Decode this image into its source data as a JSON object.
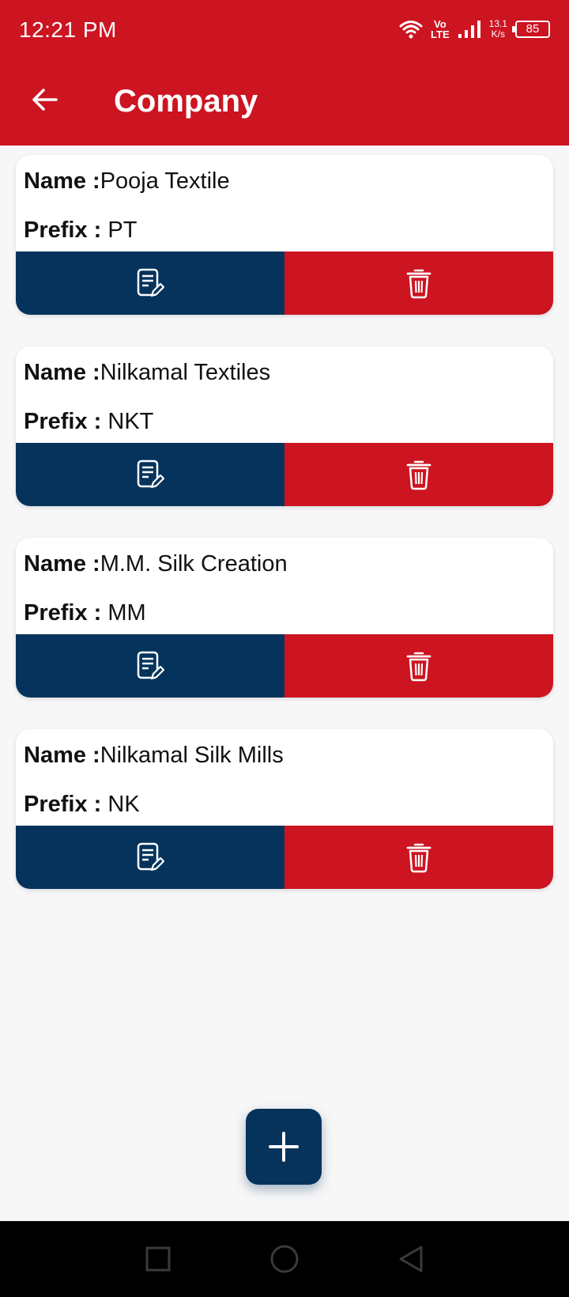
{
  "status_bar": {
    "time": "12:21 PM",
    "volte_top": "Vo",
    "volte_bottom": "LTE",
    "speed_value": "13.1",
    "speed_unit": "K/s",
    "battery": "85"
  },
  "app_bar": {
    "title": "Company",
    "back_icon": "arrow-left-icon",
    "color": "#cd1421"
  },
  "labels": {
    "name": "Name :",
    "prefix": "Prefix :"
  },
  "companies": [
    {
      "name": "Pooja Textile",
      "prefix": "PT"
    },
    {
      "name": "Nilkamal Textiles",
      "prefix": "NKT"
    },
    {
      "name": "M.M. Silk Creation",
      "prefix": "MM"
    },
    {
      "name": "Nilkamal Silk Mills",
      "prefix": "NK"
    }
  ],
  "actions": {
    "edit_icon": "edit-document-icon",
    "delete_icon": "trash-icon",
    "edit_color": "#05335c",
    "delete_color": "#cd1421"
  },
  "fab": {
    "icon": "plus-icon"
  },
  "nav": {
    "recent_icon": "square-icon",
    "home_icon": "circle-icon",
    "back_icon": "triangle-back-icon"
  }
}
